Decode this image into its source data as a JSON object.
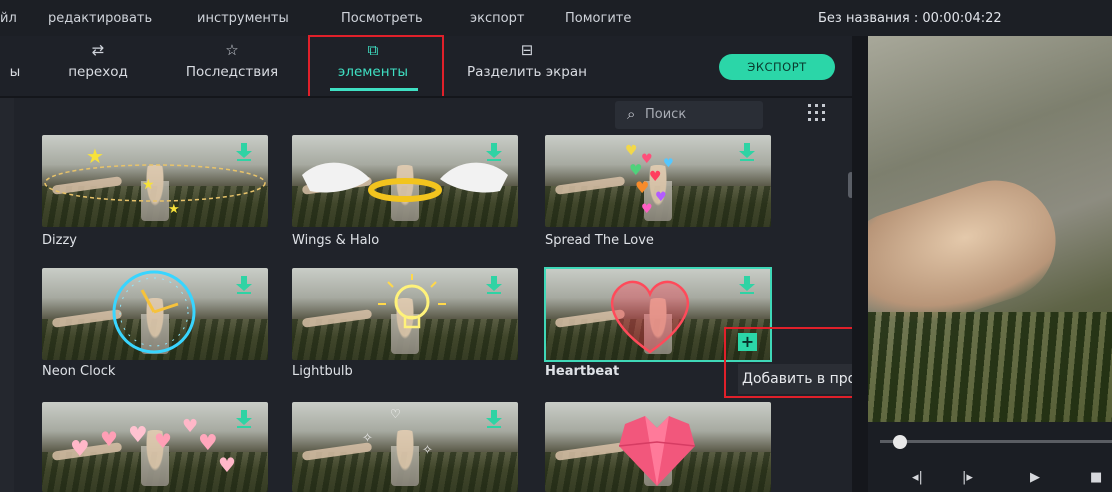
{
  "menu": {
    "items": [
      "йл",
      "редактировать",
      "инструменты",
      "Посмотреть",
      "экспорт",
      "Помогите"
    ],
    "title": "Без названия : 00:00:04:22"
  },
  "tabs": [
    {
      "label": "ы",
      "icon": "tab-icon-partial"
    },
    {
      "label": "переход",
      "icon": "transition-icon"
    },
    {
      "label": "Последствия",
      "icon": "effects-star-icon"
    },
    {
      "label": "элементы",
      "icon": "elements-icon",
      "active": true
    },
    {
      "label": "Разделить экран",
      "icon": "split-screen-icon"
    }
  ],
  "export_button": "ЭКСПОРТ",
  "search": {
    "placeholder": "Поиск"
  },
  "elements": [
    {
      "label": "Dizzy"
    },
    {
      "label": "Wings & Halo"
    },
    {
      "label": "Spread The Love"
    },
    {
      "label": "Neon Clock"
    },
    {
      "label": "Lightbulb"
    },
    {
      "label": "Heartbeat",
      "selected": true
    },
    {
      "label": ""
    },
    {
      "label": ""
    },
    {
      "label": ""
    }
  ],
  "tooltip": "Добавить в проект",
  "colors": {
    "accent": "#3fe0c3",
    "highlight": "#e0202a",
    "export": "#2bd6a8"
  }
}
